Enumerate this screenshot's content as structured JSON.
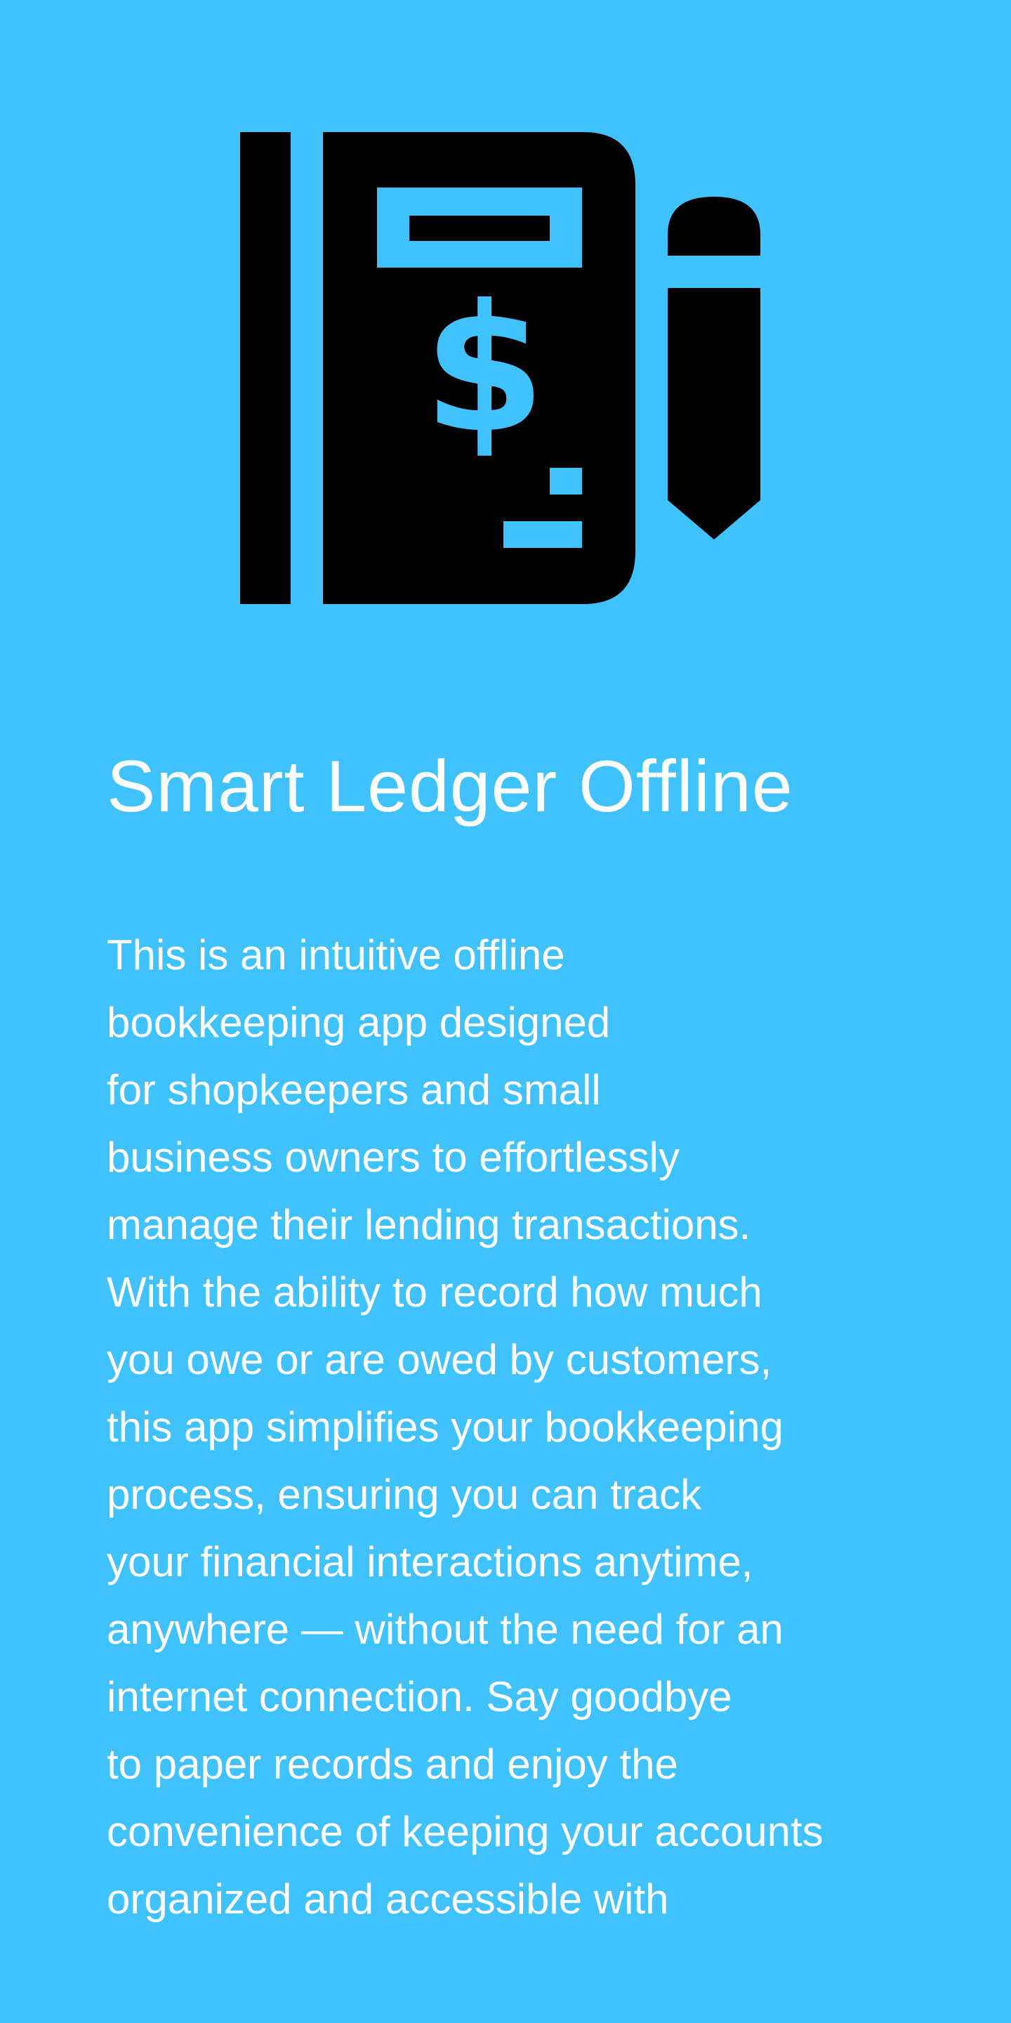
{
  "colors": {
    "background": "#3fc2fe",
    "icon": "#000000",
    "text": "#ffffff"
  },
  "logo": {
    "icon_name": "ledger-book-dollar-pencil-icon",
    "dollar_glyph": "$"
  },
  "title": "Smart Ledger Offline",
  "description_lines": [
    "This is an intuitive offline",
    "bookkeeping app designed",
    "for shopkeepers and small",
    "business owners to effortlessly",
    "manage their lending transactions.",
    "With the ability to record how much",
    "you owe or are owed by customers,",
    "this app simplifies your bookkeeping",
    "process, ensuring you can track",
    "your financial interactions anytime,",
    "anywhere — without the need for an",
    "internet connection. Say goodbye",
    "to paper records and enjoy the",
    "convenience of keeping your accounts",
    "organized and accessible with"
  ]
}
